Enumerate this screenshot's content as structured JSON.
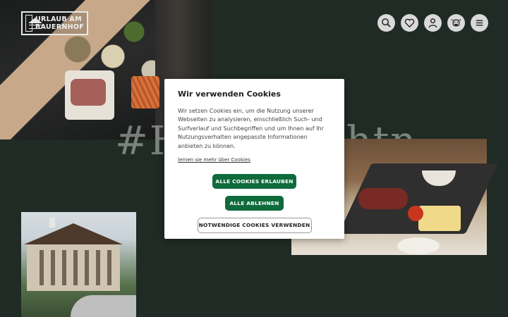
{
  "logo": {
    "line1": "URLAUB AM",
    "line2": "BAUERNHOF"
  },
  "header": {
    "icons": [
      "search-icon",
      "heart-icon",
      "user-icon",
      "cow-icon",
      "menu-icon"
    ]
  },
  "hashtag": "#Hausmachtn",
  "cookie_dialog": {
    "title": "Wir verwenden Cookies",
    "text": "Wir setzen Cookies ein, um die Nutzung unserer Webseiten zu analysieren, einschließlich Such- und Surfverlauf und Suchbegriffen und um Ihnen auf Ihr Nutzungsverhalten angepasste Informationen anbieten zu können.",
    "learn_more": "lernen sie mehr über Cookies",
    "allow_all": "ALLE COOKIES ERLAUBEN",
    "deny_all": "ALLE ABLEHNEN",
    "necessary_only": "NOTWENDIGE COOKIES VERWENDEN"
  },
  "colors": {
    "background": "#1f2b24",
    "primary_button": "#0f6b3c",
    "icon_button": "#d9d9d9"
  }
}
